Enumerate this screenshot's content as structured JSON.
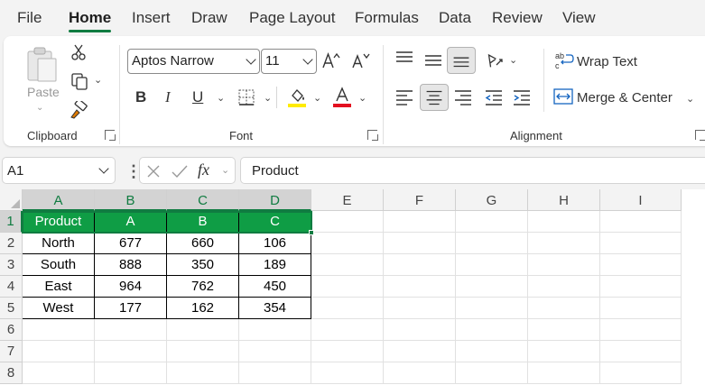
{
  "menu": {
    "tabs": [
      "File",
      "Home",
      "Insert",
      "Draw",
      "Page Layout",
      "Formulas",
      "Data",
      "Review",
      "View"
    ],
    "active": "Home"
  },
  "ribbon": {
    "clipboard": {
      "label": "Clipboard",
      "paste_label": "Paste"
    },
    "font": {
      "label": "Font",
      "font_name": "Aptos Narrow",
      "font_size": "11"
    },
    "alignment": {
      "label": "Alignment",
      "wrap_text": "Wrap Text",
      "merge_center": "Merge & Center"
    }
  },
  "formula_bar": {
    "name_box": "A1",
    "fx": "fx",
    "formula": "Product"
  },
  "sheet": {
    "columns": [
      "A",
      "B",
      "C",
      "D",
      "E",
      "F",
      "G",
      "H",
      "I"
    ],
    "rows": [
      "1",
      "2",
      "3",
      "4",
      "5",
      "6",
      "7",
      "8"
    ],
    "header": [
      "Product",
      "A",
      "B",
      "C"
    ],
    "data": [
      [
        "North",
        "677",
        "660",
        "106"
      ],
      [
        "South",
        "888",
        "350",
        "189"
      ],
      [
        "East",
        "964",
        "762",
        "450"
      ],
      [
        "West",
        "177",
        "162",
        "354"
      ]
    ]
  },
  "colors": {
    "accent": "#107c41",
    "header_fill": "#0f9d45"
  }
}
